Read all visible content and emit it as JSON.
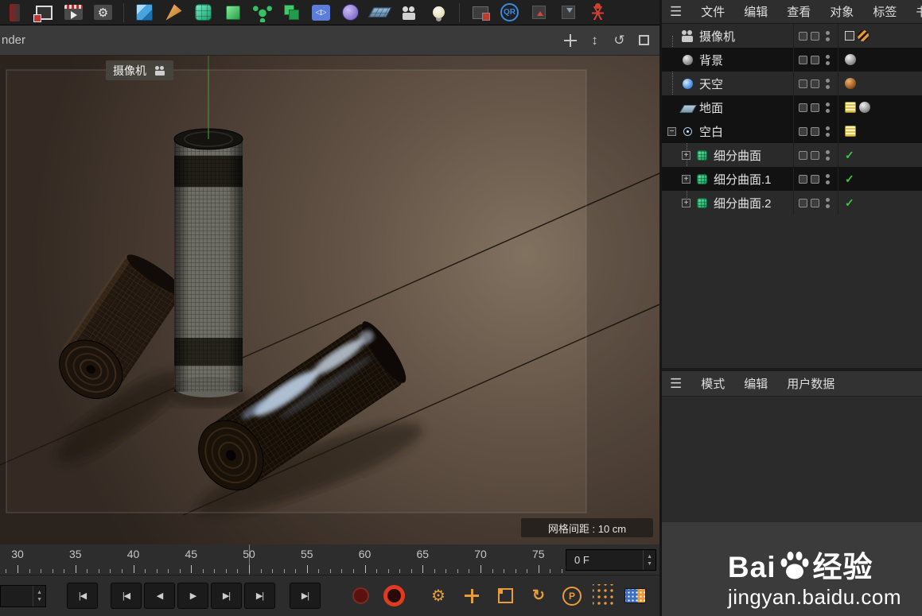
{
  "glyphs": {
    "hamburger": "☰",
    "plus": "+",
    "minus": "−",
    "check": "✓",
    "spinner_up": "▲",
    "spinner_down": "▼"
  },
  "toolbar": {
    "icons": [
      {
        "name": "clipped-left"
      },
      {
        "name": "render-view"
      },
      {
        "name": "render-picture-viewer"
      },
      {
        "name": "edit-render-settings",
        "text": "⚙"
      },
      {
        "name": "separator"
      },
      {
        "name": "add-cube"
      },
      {
        "name": "spline-pen"
      },
      {
        "name": "subdivision-surface"
      },
      {
        "name": "generator-cube"
      },
      {
        "name": "array-object"
      },
      {
        "name": "instance-object"
      },
      {
        "name": "symmetry-object",
        "text": "◁▷"
      },
      {
        "name": "metaball-object"
      },
      {
        "name": "floor-object"
      },
      {
        "name": "camera-object"
      },
      {
        "name": "light-object"
      },
      {
        "name": "separator"
      },
      {
        "name": "shader-icon"
      },
      {
        "name": "qr-plugin",
        "text": "QR"
      },
      {
        "name": "coordinates-a"
      },
      {
        "name": "coordinates-b"
      },
      {
        "name": "joint-tool"
      }
    ]
  },
  "viewport": {
    "header_label": "nder",
    "camera_label": "摄像机",
    "grid_spacing_label": "网格间距 : 10 cm"
  },
  "viewport_nav": [
    {
      "name": "pan-view",
      "kind": "pan"
    },
    {
      "name": "dolly-view",
      "kind": "dolly",
      "glyph": "↕"
    },
    {
      "name": "orbit-view",
      "kind": "orbit",
      "glyph": "↺"
    },
    {
      "name": "maximize-view",
      "kind": "maximize"
    }
  ],
  "object_manager": {
    "menu_items": [
      "文件",
      "编辑",
      "查看",
      "对象",
      "标签",
      "书签"
    ],
    "objects": [
      {
        "name": "摄像机",
        "icon": "camera",
        "depth": 0,
        "selected": false,
        "expander": "none",
        "tags": [
          "target-tag",
          "stripe-ball-orange"
        ]
      },
      {
        "name": "背景",
        "icon": "background",
        "depth": 0,
        "selected": true,
        "expander": "none",
        "tags": [
          "sphere-gray"
        ]
      },
      {
        "name": "天空",
        "icon": "sky",
        "depth": 0,
        "selected": false,
        "expander": "none",
        "tags": [
          "sphere-brown"
        ]
      },
      {
        "name": "地面",
        "icon": "floor",
        "depth": 0,
        "selected": true,
        "expander": "none",
        "tags": [
          "stripe-tag-yellow",
          "sphere-gray"
        ]
      },
      {
        "name": "空白",
        "icon": "null",
        "depth": 0,
        "selected": true,
        "expander": "minus",
        "tags": [
          "stripe-tag-yellow"
        ]
      },
      {
        "name": "细分曲面",
        "icon": "subdivision",
        "depth": 1,
        "selected": false,
        "expander": "plus",
        "tags": [
          "check-green"
        ]
      },
      {
        "name": "细分曲面.1",
        "icon": "subdivision",
        "depth": 1,
        "selected": true,
        "expander": "plus",
        "tags": [
          "check-green"
        ]
      },
      {
        "name": "细分曲面.2",
        "icon": "subdivision",
        "depth": 1,
        "selected": false,
        "expander": "plus",
        "tags": [
          "check-green"
        ]
      }
    ]
  },
  "attribute_manager": {
    "menu_items": [
      "模式",
      "编辑",
      "用户数据"
    ]
  },
  "timeline": {
    "tick_labels": [
      "30",
      "35",
      "40",
      "45",
      "50",
      "55",
      "60",
      "65",
      "70",
      "75"
    ],
    "tick_values": [
      30,
      35,
      40,
      45,
      50,
      55,
      60,
      65,
      70,
      75
    ],
    "marker_frame": 50,
    "frame_field_value": "0 F"
  },
  "transport": {
    "playback": [
      {
        "name": "goto-start",
        "glyph": "|◀"
      },
      {
        "name": "previous-key",
        "glyph": "|◀"
      },
      {
        "name": "previous-frame",
        "glyph": "◀"
      },
      {
        "name": "play-forwards",
        "glyph": "▶"
      },
      {
        "name": "next-frame",
        "glyph": "▶|"
      },
      {
        "name": "next-key",
        "glyph": "▶|"
      },
      {
        "name": "goto-end",
        "glyph": "▶|"
      }
    ],
    "records": [
      {
        "name": "record-active-objects",
        "kind": "rec-dark"
      },
      {
        "name": "autokeying",
        "kind": "rec-bright"
      },
      {
        "name": "keyframe-selection",
        "kind": "gear",
        "text": "⚙"
      },
      {
        "name": "record-position",
        "kind": "pos"
      },
      {
        "name": "record-scale",
        "kind": "scale"
      },
      {
        "name": "record-rotation",
        "kind": "rot",
        "text": "↻"
      },
      {
        "name": "record-parameter",
        "kind": "param",
        "text": "P"
      },
      {
        "name": "record-pla",
        "kind": "pla"
      },
      {
        "name": "film-marker",
        "kind": "film"
      }
    ]
  },
  "watermark": {
    "brand_prefix": "Bai",
    "brand_suffix": "经验",
    "url": "jingyan.baidu.com"
  }
}
